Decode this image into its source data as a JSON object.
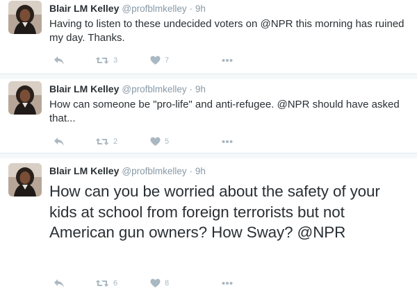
{
  "colors": {
    "background": "#f5f8fa",
    "card": "#ffffff",
    "text": "#292f33",
    "secondary": "#8899a6",
    "icon": "#aab8c2"
  },
  "tweets": [
    {
      "author_name": "Blair LM Kelley",
      "handle": "@profblmkelley",
      "separator": "·",
      "time": "9h",
      "text": "Having to listen to these undecided voters on @NPR this morning has ruined my day. Thanks.",
      "retweets": "3",
      "likes": "7",
      "icons": [
        "reply-icon",
        "retweet-icon",
        "heart-icon",
        "more-icon"
      ]
    },
    {
      "author_name": "Blair LM Kelley",
      "handle": "@profblmkelley",
      "separator": "·",
      "time": "9h",
      "text": "How can someone be \"pro-life\" and anti-refugee. @NPR should have asked that...",
      "retweets": "2",
      "likes": "5",
      "icons": [
        "reply-icon",
        "retweet-icon",
        "heart-icon",
        "more-icon"
      ]
    },
    {
      "author_name": "Blair LM Kelley",
      "handle": "@profblmkelley",
      "separator": "·",
      "time": "9h",
      "text": "How can you be worried about the safety of your kids at school from foreign terrorists but not American gun owners? How Sway? @NPR",
      "retweets": "6",
      "likes": "8",
      "icons": [
        "reply-icon",
        "retweet-icon",
        "heart-icon",
        "more-icon"
      ]
    }
  ]
}
